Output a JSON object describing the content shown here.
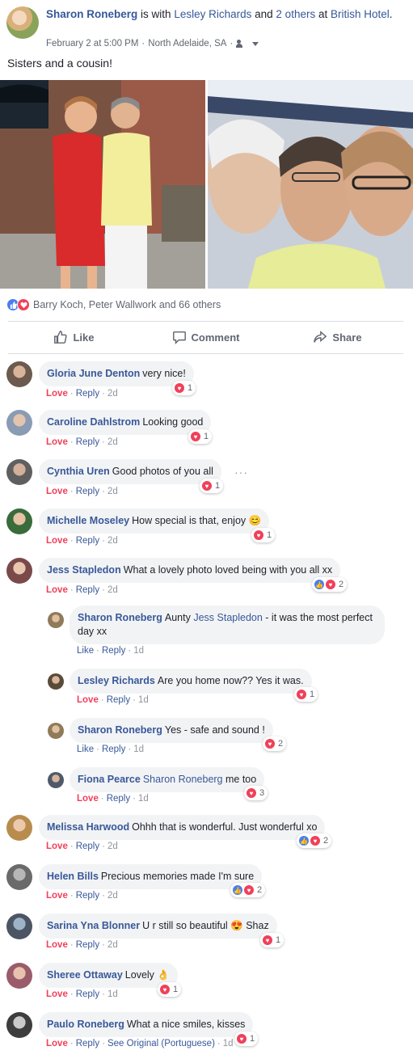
{
  "post": {
    "author": "Sharon Roneberg",
    "with_text": "is with",
    "tagged": "Lesley Richards",
    "and_text": "and",
    "others_link": "2 others",
    "at_text": "at",
    "place": "British Hotel",
    "period": ".",
    "time": "February 2 at 5:00 PM",
    "dot1": "·",
    "location": "North Adelaide, SA",
    "dot2": "·",
    "text": "Sisters and a cousin!"
  },
  "reactions": {
    "summary": "Barry Koch, Peter Wallwork and 66 others"
  },
  "actions": {
    "like": "Like",
    "comment": "Comment",
    "share": "Share"
  },
  "labels": {
    "love": "Love",
    "like": "Like",
    "reply": "Reply",
    "sep": "·",
    "see_original": "See Original (Portuguese)",
    "more": "···"
  },
  "comments": [
    {
      "name": "Gloria June Denton",
      "text": "very nice!",
      "time": "2d",
      "count": "1"
    },
    {
      "name": "Caroline Dahlstrom",
      "text": "Looking good",
      "time": "2d",
      "count": "1"
    },
    {
      "name": "Cynthia Uren",
      "text": "Good photos of you all",
      "time": "2d",
      "count": "1"
    },
    {
      "name": "Michelle Moseley",
      "text": "How special is that, enjoy 😊",
      "time": "2d",
      "count": "1"
    },
    {
      "name": "Jess Stapledon",
      "text": "What a lovely photo loved being with you all xx",
      "time": "2d",
      "count": "2"
    },
    {
      "name": "Sharon Roneberg",
      "pre": "Aunty",
      "mention": "Jess Stapledon",
      "text": "- it was the most perfect day xx",
      "time": "1d"
    },
    {
      "name": "Lesley Richards",
      "text": "Are you home now?? Yes it was.",
      "time": "1d",
      "count": "1"
    },
    {
      "name": "Sharon Roneberg",
      "text": "Yes - safe and sound !",
      "time": "1d",
      "count": "2"
    },
    {
      "name": "Fiona Pearce",
      "mention": "Sharon Roneberg",
      "text": "me too",
      "time": "1d",
      "count": "3"
    },
    {
      "name": "Melissa Harwood",
      "text": "Ohhh that is wonderful. Just wonderful xo",
      "time": "2d",
      "count": "2"
    },
    {
      "name": "Helen Bills",
      "text": "Precious memories made I'm sure",
      "time": "2d",
      "count": "2"
    },
    {
      "name": "Sarina Yna Blonner",
      "text": "U r still so beautiful 😍 Shaz",
      "time": "2d",
      "count": "1"
    },
    {
      "name": "Sheree Ottaway",
      "text": "Lovely 👌",
      "time": "1d",
      "count": "1"
    },
    {
      "name": "Paulo Roneberg",
      "text": "What a nice smiles, kisses",
      "time": "1d",
      "count": "1"
    }
  ],
  "colors": {
    "link": "#385898",
    "love": "#f0405a",
    "like": "#4a7ef0",
    "bubble": "#f2f3f5"
  }
}
